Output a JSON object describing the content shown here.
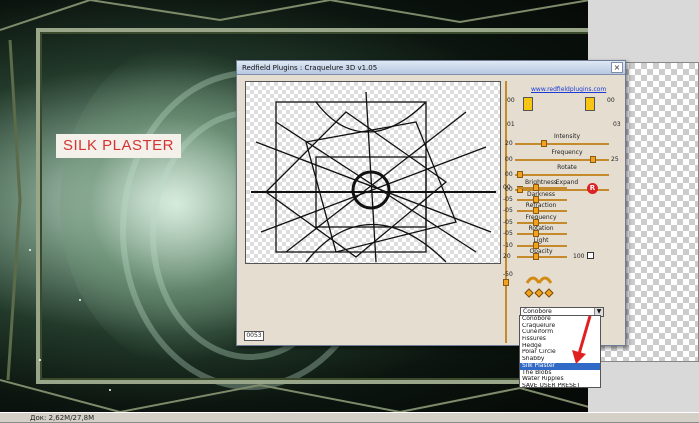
{
  "dialog": {
    "title": "Redfield Plugins : Craquelure 3D  v1.05",
    "close": "×",
    "link": "www.redfieldplugins.com",
    "preview_counter": "0053"
  },
  "left_image": {
    "label": "SILK PLASTER"
  },
  "sliders_top": [
    {
      "label": "Intensity",
      "left_val": "20",
      "right_val": "",
      "fraction": 0.3
    },
    {
      "label": "Frequency",
      "left_val": "00",
      "right_val": "25",
      "fraction": 0.85
    },
    {
      "label": "Rotate",
      "left_val": "00",
      "right_val": "",
      "fraction": 0.02
    },
    {
      "label": "Expand",
      "left_val": "00",
      "right_val": "",
      "fraction": 0.02
    }
  ],
  "top_values": {
    "left_top": "00",
    "right_top": "00",
    "left_val": "01",
    "right_val": "03"
  },
  "sliders_light": [
    {
      "label": "Brightness",
      "left_val": "00"
    },
    {
      "label": "Darkness",
      "left_val": "-05"
    },
    {
      "label": "Refraction",
      "left_val": "-05"
    },
    {
      "label": "Frequency",
      "left_val": "-05"
    },
    {
      "label": "Rotation",
      "left_val": "-05"
    },
    {
      "label": "Light",
      "left_val": "-10"
    },
    {
      "label": "Opacity",
      "left_val": "20",
      "right_val": "100"
    }
  ],
  "vertical_value": "-50",
  "reset_badge": "R",
  "preset": {
    "selected": "Conobore",
    "options": [
      "Conobore",
      "Craquelure",
      "Cuneiform",
      "Fissures",
      "Hedge",
      "Polar Circle",
      "Shabby",
      "Silk Plaster",
      "The Blobs",
      "Water Ripples",
      "SAVE USER PRESET"
    ],
    "highlighted_index": 7
  },
  "status_bar": "Док: 2,62M/27,8M",
  "colors": {
    "accent": "#f1a320",
    "selection": "#3169c6",
    "label_red": "#d43434"
  }
}
